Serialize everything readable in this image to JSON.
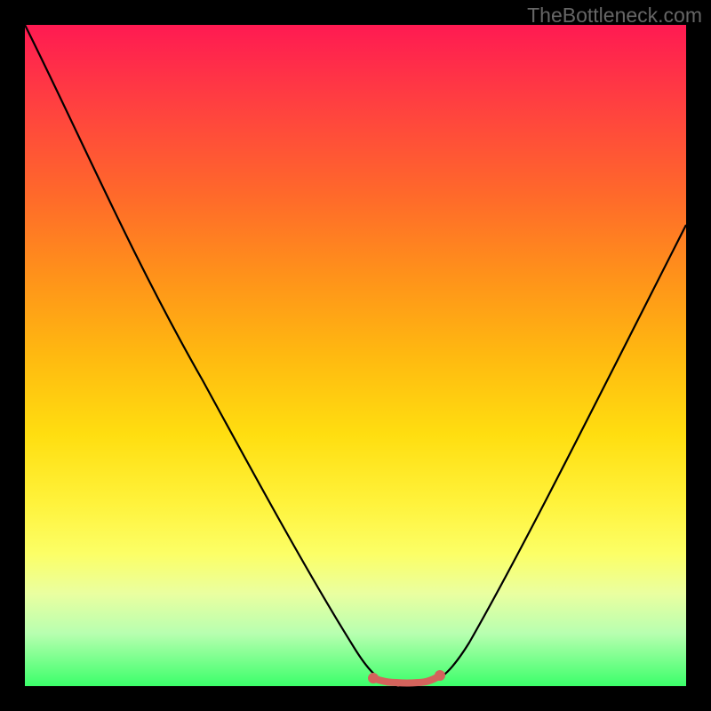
{
  "watermark": "TheBottleneck.com",
  "chart_data": {
    "type": "line",
    "title": "",
    "xlabel": "",
    "ylabel": "",
    "xlim": [
      0,
      100
    ],
    "ylim": [
      0,
      100
    ],
    "series": [
      {
        "name": "bottleneck-curve",
        "x": [
          0,
          10,
          20,
          30,
          40,
          48,
          52,
          56,
          60,
          64,
          70,
          80,
          90,
          100
        ],
        "y": [
          100,
          83,
          66,
          50,
          33,
          12,
          4,
          1,
          1,
          4,
          12,
          30,
          50,
          70
        ]
      }
    ],
    "highlight_band": {
      "name": "optimal-range",
      "x_start": 52,
      "x_end": 63,
      "y": 1,
      "color": "#d4635c"
    },
    "colors": {
      "curve": "#000000",
      "highlight": "#d4635c",
      "gradient_top": "#ff1a52",
      "gradient_bottom": "#3bff6a",
      "frame": "#000000"
    }
  }
}
